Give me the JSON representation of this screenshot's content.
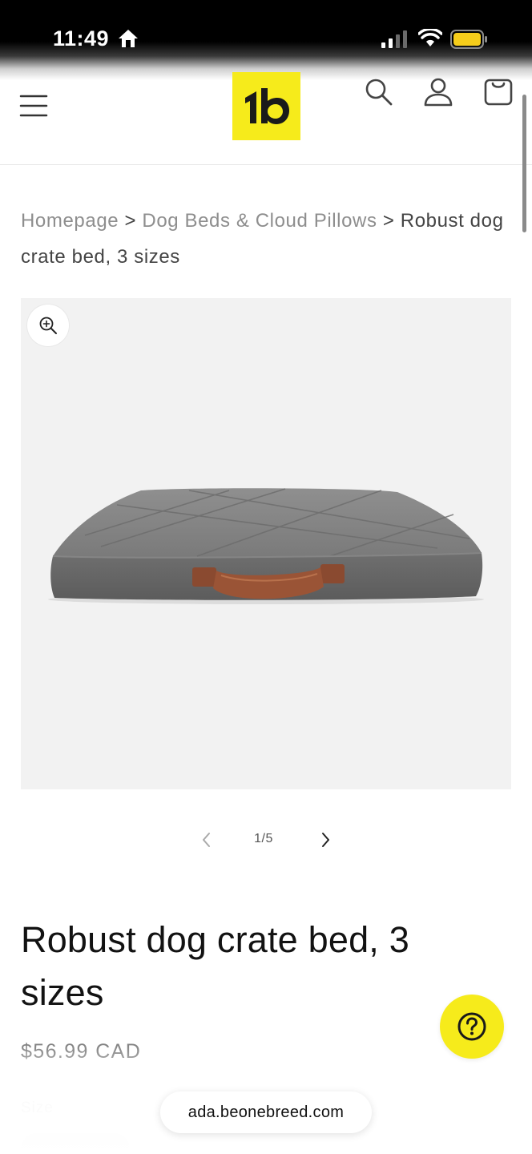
{
  "status_bar": {
    "time": "11:49"
  },
  "header": {
    "logo_text": "1b",
    "brand_color": "#f6eb1b",
    "icons": [
      "menu-icon",
      "search-icon",
      "account-icon",
      "cart-icon"
    ]
  },
  "breadcrumb": {
    "items": [
      "Homepage",
      "Dog Beds & Cloud Pillows",
      "Robust dog crate bed, 3 sizes"
    ],
    "separator": ">"
  },
  "gallery": {
    "counter": "1/5",
    "zoom_icon": "zoom-in-icon",
    "prev_icon": "chevron-left-icon",
    "next_icon": "chevron-right-icon"
  },
  "product": {
    "title": "Robust dog crate bed, 3 sizes",
    "price": "$56.99 CAD",
    "size_label": "Size"
  },
  "help": {
    "icon": "question-mark-icon"
  },
  "browser": {
    "url": "ada.beonebreed.com"
  }
}
